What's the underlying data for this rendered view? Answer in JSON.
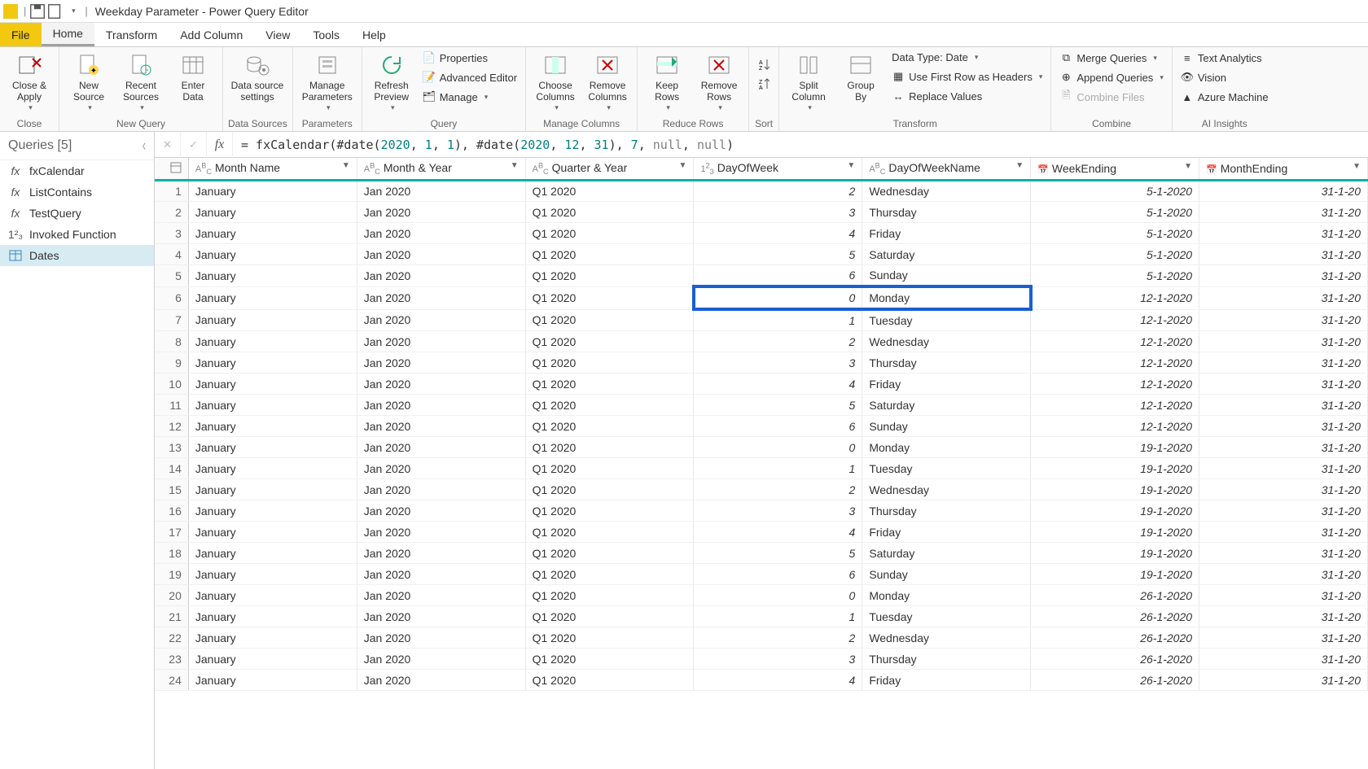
{
  "title": "Weekday Parameter - Power Query Editor",
  "menutabs": {
    "file": "File",
    "home": "Home",
    "transform": "Transform",
    "addcolumn": "Add Column",
    "view": "View",
    "tools": "Tools",
    "help": "Help"
  },
  "ribbon": {
    "close_apply": "Close &\nApply",
    "group_close": "Close",
    "new_source": "New\nSource",
    "recent_sources": "Recent\nSources",
    "enter_data": "Enter\nData",
    "group_newquery": "New Query",
    "data_source_settings": "Data source\nsettings",
    "group_datasources": "Data Sources",
    "manage_parameters": "Manage\nParameters",
    "group_parameters": "Parameters",
    "refresh_preview": "Refresh\nPreview",
    "properties": "Properties",
    "advanced_editor": "Advanced Editor",
    "manage": "Manage",
    "group_query": "Query",
    "choose_columns": "Choose\nColumns",
    "remove_columns": "Remove\nColumns",
    "group_managecolumns": "Manage Columns",
    "keep_rows": "Keep\nRows",
    "remove_rows": "Remove\nRows",
    "group_reducerows": "Reduce Rows",
    "group_sort": "Sort",
    "split_column": "Split\nColumn",
    "group_by": "Group\nBy",
    "data_type": "Data Type: Date",
    "first_row_headers": "Use First Row as Headers",
    "replace_values": "Replace Values",
    "group_transform": "Transform",
    "merge_queries": "Merge Queries",
    "append_queries": "Append Queries",
    "combine_files": "Combine Files",
    "group_combine": "Combine",
    "text_analytics": "Text Analytics",
    "vision": "Vision",
    "azure_ml": "Azure Machine",
    "group_ai": "AI Insights"
  },
  "queries": {
    "header": "Queries [5]",
    "items": [
      {
        "name": "fxCalendar",
        "icon": "fx"
      },
      {
        "name": "ListContains",
        "icon": "fx"
      },
      {
        "name": "TestQuery",
        "icon": "fx"
      },
      {
        "name": "Invoked Function",
        "icon": "num"
      },
      {
        "name": "Dates",
        "icon": "table",
        "selected": true
      }
    ]
  },
  "formula": {
    "raw": "= fxCalendar(#date(2020, 1, 1), #date(2020, 12, 31), 7, null, null)"
  },
  "columns": [
    {
      "type": "ABC",
      "label": "Month Name"
    },
    {
      "type": "ABC",
      "label": "Month & Year"
    },
    {
      "type": "ABC",
      "label": "Quarter & Year"
    },
    {
      "type": "123",
      "label": "DayOfWeek"
    },
    {
      "type": "ABC",
      "label": "DayOfWeekName"
    },
    {
      "type": "date",
      "label": "WeekEnding"
    },
    {
      "type": "date",
      "label": "MonthEnding"
    }
  ],
  "rows": [
    {
      "n": 1,
      "mn": "January",
      "my": "Jan 2020",
      "qy": "Q1 2020",
      "dow": 2,
      "down": "Wednesday",
      "we": "5-1-2020",
      "me": "31-1-20"
    },
    {
      "n": 2,
      "mn": "January",
      "my": "Jan 2020",
      "qy": "Q1 2020",
      "dow": 3,
      "down": "Thursday",
      "we": "5-1-2020",
      "me": "31-1-20"
    },
    {
      "n": 3,
      "mn": "January",
      "my": "Jan 2020",
      "qy": "Q1 2020",
      "dow": 4,
      "down": "Friday",
      "we": "5-1-2020",
      "me": "31-1-20"
    },
    {
      "n": 4,
      "mn": "January",
      "my": "Jan 2020",
      "qy": "Q1 2020",
      "dow": 5,
      "down": "Saturday",
      "we": "5-1-2020",
      "me": "31-1-20"
    },
    {
      "n": 5,
      "mn": "January",
      "my": "Jan 2020",
      "qy": "Q1 2020",
      "dow": 6,
      "down": "Sunday",
      "we": "5-1-2020",
      "me": "31-1-20"
    },
    {
      "n": 6,
      "mn": "January",
      "my": "Jan 2020",
      "qy": "Q1 2020",
      "dow": 0,
      "down": "Monday",
      "we": "12-1-2020",
      "me": "31-1-20",
      "hl": true
    },
    {
      "n": 7,
      "mn": "January",
      "my": "Jan 2020",
      "qy": "Q1 2020",
      "dow": 1,
      "down": "Tuesday",
      "we": "12-1-2020",
      "me": "31-1-20"
    },
    {
      "n": 8,
      "mn": "January",
      "my": "Jan 2020",
      "qy": "Q1 2020",
      "dow": 2,
      "down": "Wednesday",
      "we": "12-1-2020",
      "me": "31-1-20"
    },
    {
      "n": 9,
      "mn": "January",
      "my": "Jan 2020",
      "qy": "Q1 2020",
      "dow": 3,
      "down": "Thursday",
      "we": "12-1-2020",
      "me": "31-1-20"
    },
    {
      "n": 10,
      "mn": "January",
      "my": "Jan 2020",
      "qy": "Q1 2020",
      "dow": 4,
      "down": "Friday",
      "we": "12-1-2020",
      "me": "31-1-20"
    },
    {
      "n": 11,
      "mn": "January",
      "my": "Jan 2020",
      "qy": "Q1 2020",
      "dow": 5,
      "down": "Saturday",
      "we": "12-1-2020",
      "me": "31-1-20"
    },
    {
      "n": 12,
      "mn": "January",
      "my": "Jan 2020",
      "qy": "Q1 2020",
      "dow": 6,
      "down": "Sunday",
      "we": "12-1-2020",
      "me": "31-1-20"
    },
    {
      "n": 13,
      "mn": "January",
      "my": "Jan 2020",
      "qy": "Q1 2020",
      "dow": 0,
      "down": "Monday",
      "we": "19-1-2020",
      "me": "31-1-20"
    },
    {
      "n": 14,
      "mn": "January",
      "my": "Jan 2020",
      "qy": "Q1 2020",
      "dow": 1,
      "down": "Tuesday",
      "we": "19-1-2020",
      "me": "31-1-20"
    },
    {
      "n": 15,
      "mn": "January",
      "my": "Jan 2020",
      "qy": "Q1 2020",
      "dow": 2,
      "down": "Wednesday",
      "we": "19-1-2020",
      "me": "31-1-20"
    },
    {
      "n": 16,
      "mn": "January",
      "my": "Jan 2020",
      "qy": "Q1 2020",
      "dow": 3,
      "down": "Thursday",
      "we": "19-1-2020",
      "me": "31-1-20"
    },
    {
      "n": 17,
      "mn": "January",
      "my": "Jan 2020",
      "qy": "Q1 2020",
      "dow": 4,
      "down": "Friday",
      "we": "19-1-2020",
      "me": "31-1-20"
    },
    {
      "n": 18,
      "mn": "January",
      "my": "Jan 2020",
      "qy": "Q1 2020",
      "dow": 5,
      "down": "Saturday",
      "we": "19-1-2020",
      "me": "31-1-20"
    },
    {
      "n": 19,
      "mn": "January",
      "my": "Jan 2020",
      "qy": "Q1 2020",
      "dow": 6,
      "down": "Sunday",
      "we": "19-1-2020",
      "me": "31-1-20"
    },
    {
      "n": 20,
      "mn": "January",
      "my": "Jan 2020",
      "qy": "Q1 2020",
      "dow": 0,
      "down": "Monday",
      "we": "26-1-2020",
      "me": "31-1-20"
    },
    {
      "n": 21,
      "mn": "January",
      "my": "Jan 2020",
      "qy": "Q1 2020",
      "dow": 1,
      "down": "Tuesday",
      "we": "26-1-2020",
      "me": "31-1-20"
    },
    {
      "n": 22,
      "mn": "January",
      "my": "Jan 2020",
      "qy": "Q1 2020",
      "dow": 2,
      "down": "Wednesday",
      "we": "26-1-2020",
      "me": "31-1-20"
    },
    {
      "n": 23,
      "mn": "January",
      "my": "Jan 2020",
      "qy": "Q1 2020",
      "dow": 3,
      "down": "Thursday",
      "we": "26-1-2020",
      "me": "31-1-20"
    },
    {
      "n": 24,
      "mn": "January",
      "my": "Jan 2020",
      "qy": "Q1 2020",
      "dow": 4,
      "down": "Friday",
      "we": "26-1-2020",
      "me": "31-1-20"
    }
  ]
}
